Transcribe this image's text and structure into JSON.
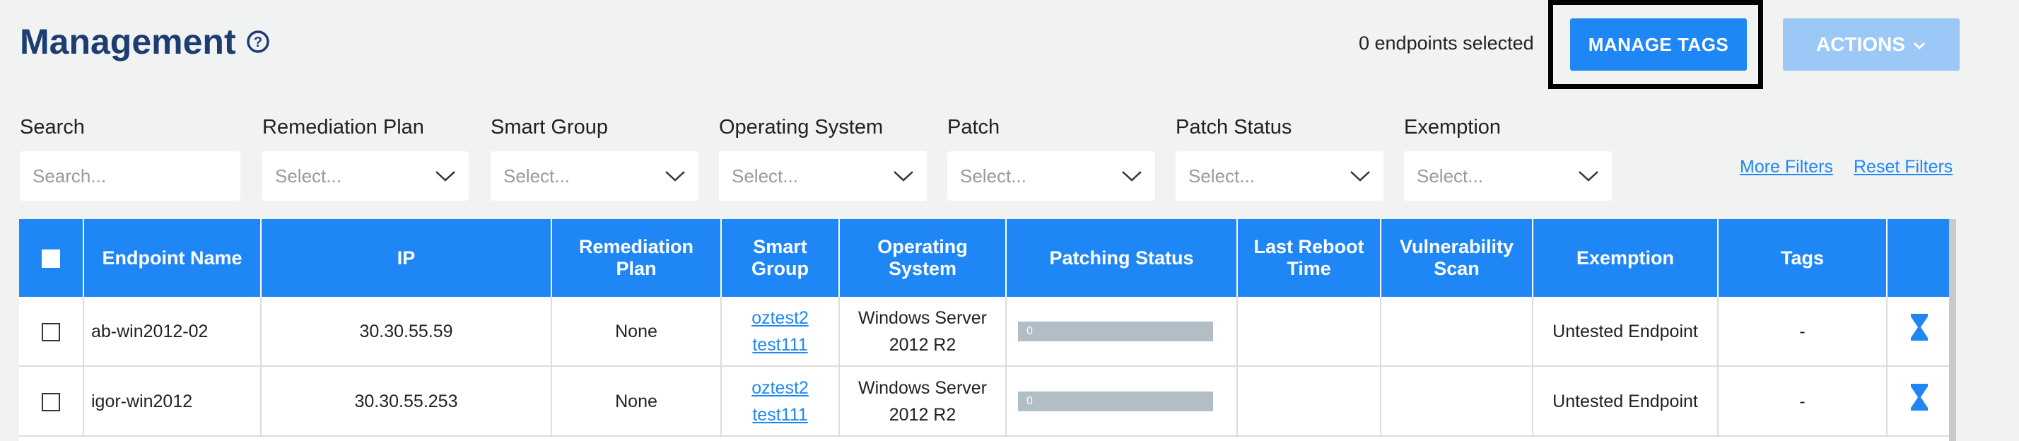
{
  "header": {
    "title": "Management",
    "selected_count": "0 endpoints selected",
    "manage_tags_label": "MANAGE TAGS",
    "actions_label": "ACTIONS"
  },
  "filters": [
    {
      "label": "Search",
      "placeholder": "Search..."
    },
    {
      "label": "Remediation Plan",
      "placeholder": "Select..."
    },
    {
      "label": "Smart Group",
      "placeholder": "Select..."
    },
    {
      "label": "Operating System",
      "placeholder": "Select..."
    },
    {
      "label": "Patch",
      "placeholder": "Select..."
    },
    {
      "label": "Patch Status",
      "placeholder": "Select..."
    },
    {
      "label": "Exemption",
      "placeholder": "Select..."
    }
  ],
  "links": {
    "more_filters": "More Filters",
    "reset_filters": "Reset Filters"
  },
  "table": {
    "columns": [
      "Endpoint Name",
      "IP",
      "Remediation Plan",
      "Smart Group",
      "Operating System",
      "Patching Status",
      "Last Reboot Time",
      "Vulnerability Scan",
      "Exemption",
      "Tags"
    ],
    "rows": [
      {
        "name": "ab-win2012-02",
        "ip": "30.30.55.59",
        "plan": "None",
        "groups": [
          "oztest2",
          "test111"
        ],
        "os": "Windows Server 2012 R2",
        "patch_progress": "0",
        "reboot": "",
        "scan": "",
        "exemption": "Untested Endpoint",
        "tags": "-"
      },
      {
        "name": "igor-win2012",
        "ip": "30.30.55.253",
        "plan": "None",
        "groups": [
          "oztest2",
          "test111"
        ],
        "os": "Windows Server 2012 R2",
        "patch_progress": "0",
        "reboot": "",
        "scan": "",
        "exemption": "Untested Endpoint",
        "tags": "-"
      }
    ]
  },
  "colors": {
    "primary": "#1f87f5",
    "title": "#1d3d72",
    "disabled": "#9bc8f7"
  }
}
